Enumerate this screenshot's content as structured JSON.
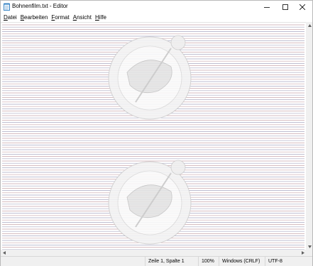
{
  "window": {
    "title": "Bohnenfilm.txt - Editor"
  },
  "menu": [
    {
      "label": "Datei",
      "accel": "D",
      "rest": "atei"
    },
    {
      "label": "Bearbeiten",
      "accel": "B",
      "rest": "earbeiten"
    },
    {
      "label": "Format",
      "accel": "F",
      "rest": "ormat"
    },
    {
      "label": "Ansicht",
      "accel": "A",
      "rest": "nsicht"
    },
    {
      "label": "Hilfe",
      "accel": "H",
      "rest": "ilfe"
    }
  ],
  "status": {
    "position": "Zeile 1, Spalte 1",
    "zoom": "100%",
    "line_ending": "Windows (CRLF)",
    "encoding": "UTF-8"
  },
  "colors": {
    "text_line_primary": "#c9a5ab",
    "text_line_secondary": "#a9a9c2",
    "statusbar_bg": "#f0f0f0"
  },
  "icons": {
    "app": "notepad-icon",
    "minimize": "minimize-icon",
    "maximize": "maximize-icon",
    "close": "close-icon"
  }
}
